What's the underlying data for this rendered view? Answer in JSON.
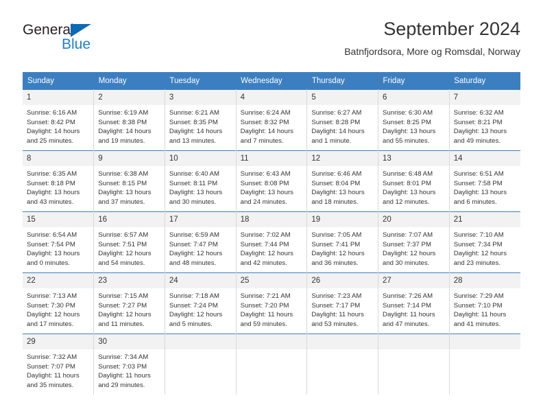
{
  "brand": {
    "name_part1": "General",
    "name_part2": "Blue",
    "triangle_color": "#0a6ab5",
    "text_color": "#1b7fd4"
  },
  "header": {
    "title": "September 2024",
    "subtitle": "Batnfjordsora, More og Romsdal, Norway"
  },
  "theme": {
    "header_bg": "#3c7fc1",
    "header_text": "#ffffff",
    "daynum_bg": "#f2f2f2",
    "cell_bg": "#ffffff",
    "grid_line": "#d8d8d8",
    "week_top_line": "#3c7fc1",
    "body_text": "#333333"
  },
  "labels": {
    "sunrise": "Sunrise:",
    "sunset": "Sunset:",
    "daylight": "Daylight:"
  },
  "weekdays": [
    "Sunday",
    "Monday",
    "Tuesday",
    "Wednesday",
    "Thursday",
    "Friday",
    "Saturday"
  ],
  "weeks": [
    [
      {
        "day": "1",
        "sunrise": "Sunrise: 6:16 AM",
        "sunset": "Sunset: 8:42 PM",
        "daylight": "Daylight: 14 hours and 25 minutes."
      },
      {
        "day": "2",
        "sunrise": "Sunrise: 6:19 AM",
        "sunset": "Sunset: 8:38 PM",
        "daylight": "Daylight: 14 hours and 19 minutes."
      },
      {
        "day": "3",
        "sunrise": "Sunrise: 6:21 AM",
        "sunset": "Sunset: 8:35 PM",
        "daylight": "Daylight: 14 hours and 13 minutes."
      },
      {
        "day": "4",
        "sunrise": "Sunrise: 6:24 AM",
        "sunset": "Sunset: 8:32 PM",
        "daylight": "Daylight: 14 hours and 7 minutes."
      },
      {
        "day": "5",
        "sunrise": "Sunrise: 6:27 AM",
        "sunset": "Sunset: 8:28 PM",
        "daylight": "Daylight: 14 hours and 1 minute."
      },
      {
        "day": "6",
        "sunrise": "Sunrise: 6:30 AM",
        "sunset": "Sunset: 8:25 PM",
        "daylight": "Daylight: 13 hours and 55 minutes."
      },
      {
        "day": "7",
        "sunrise": "Sunrise: 6:32 AM",
        "sunset": "Sunset: 8:21 PM",
        "daylight": "Daylight: 13 hours and 49 minutes."
      }
    ],
    [
      {
        "day": "8",
        "sunrise": "Sunrise: 6:35 AM",
        "sunset": "Sunset: 8:18 PM",
        "daylight": "Daylight: 13 hours and 43 minutes."
      },
      {
        "day": "9",
        "sunrise": "Sunrise: 6:38 AM",
        "sunset": "Sunset: 8:15 PM",
        "daylight": "Daylight: 13 hours and 37 minutes."
      },
      {
        "day": "10",
        "sunrise": "Sunrise: 6:40 AM",
        "sunset": "Sunset: 8:11 PM",
        "daylight": "Daylight: 13 hours and 30 minutes."
      },
      {
        "day": "11",
        "sunrise": "Sunrise: 6:43 AM",
        "sunset": "Sunset: 8:08 PM",
        "daylight": "Daylight: 13 hours and 24 minutes."
      },
      {
        "day": "12",
        "sunrise": "Sunrise: 6:46 AM",
        "sunset": "Sunset: 8:04 PM",
        "daylight": "Daylight: 13 hours and 18 minutes."
      },
      {
        "day": "13",
        "sunrise": "Sunrise: 6:48 AM",
        "sunset": "Sunset: 8:01 PM",
        "daylight": "Daylight: 13 hours and 12 minutes."
      },
      {
        "day": "14",
        "sunrise": "Sunrise: 6:51 AM",
        "sunset": "Sunset: 7:58 PM",
        "daylight": "Daylight: 13 hours and 6 minutes."
      }
    ],
    [
      {
        "day": "15",
        "sunrise": "Sunrise: 6:54 AM",
        "sunset": "Sunset: 7:54 PM",
        "daylight": "Daylight: 13 hours and 0 minutes."
      },
      {
        "day": "16",
        "sunrise": "Sunrise: 6:57 AM",
        "sunset": "Sunset: 7:51 PM",
        "daylight": "Daylight: 12 hours and 54 minutes."
      },
      {
        "day": "17",
        "sunrise": "Sunrise: 6:59 AM",
        "sunset": "Sunset: 7:47 PM",
        "daylight": "Daylight: 12 hours and 48 minutes."
      },
      {
        "day": "18",
        "sunrise": "Sunrise: 7:02 AM",
        "sunset": "Sunset: 7:44 PM",
        "daylight": "Daylight: 12 hours and 42 minutes."
      },
      {
        "day": "19",
        "sunrise": "Sunrise: 7:05 AM",
        "sunset": "Sunset: 7:41 PM",
        "daylight": "Daylight: 12 hours and 36 minutes."
      },
      {
        "day": "20",
        "sunrise": "Sunrise: 7:07 AM",
        "sunset": "Sunset: 7:37 PM",
        "daylight": "Daylight: 12 hours and 30 minutes."
      },
      {
        "day": "21",
        "sunrise": "Sunrise: 7:10 AM",
        "sunset": "Sunset: 7:34 PM",
        "daylight": "Daylight: 12 hours and 23 minutes."
      }
    ],
    [
      {
        "day": "22",
        "sunrise": "Sunrise: 7:13 AM",
        "sunset": "Sunset: 7:30 PM",
        "daylight": "Daylight: 12 hours and 17 minutes."
      },
      {
        "day": "23",
        "sunrise": "Sunrise: 7:15 AM",
        "sunset": "Sunset: 7:27 PM",
        "daylight": "Daylight: 12 hours and 11 minutes."
      },
      {
        "day": "24",
        "sunrise": "Sunrise: 7:18 AM",
        "sunset": "Sunset: 7:24 PM",
        "daylight": "Daylight: 12 hours and 5 minutes."
      },
      {
        "day": "25",
        "sunrise": "Sunrise: 7:21 AM",
        "sunset": "Sunset: 7:20 PM",
        "daylight": "Daylight: 11 hours and 59 minutes."
      },
      {
        "day": "26",
        "sunrise": "Sunrise: 7:23 AM",
        "sunset": "Sunset: 7:17 PM",
        "daylight": "Daylight: 11 hours and 53 minutes."
      },
      {
        "day": "27",
        "sunrise": "Sunrise: 7:26 AM",
        "sunset": "Sunset: 7:14 PM",
        "daylight": "Daylight: 11 hours and 47 minutes."
      },
      {
        "day": "28",
        "sunrise": "Sunrise: 7:29 AM",
        "sunset": "Sunset: 7:10 PM",
        "daylight": "Daylight: 11 hours and 41 minutes."
      }
    ],
    [
      {
        "day": "29",
        "sunrise": "Sunrise: 7:32 AM",
        "sunset": "Sunset: 7:07 PM",
        "daylight": "Daylight: 11 hours and 35 minutes."
      },
      {
        "day": "30",
        "sunrise": "Sunrise: 7:34 AM",
        "sunset": "Sunset: 7:03 PM",
        "daylight": "Daylight: 11 hours and 29 minutes."
      },
      {
        "day": "",
        "sunrise": "",
        "sunset": "",
        "daylight": ""
      },
      {
        "day": "",
        "sunrise": "",
        "sunset": "",
        "daylight": ""
      },
      {
        "day": "",
        "sunrise": "",
        "sunset": "",
        "daylight": ""
      },
      {
        "day": "",
        "sunrise": "",
        "sunset": "",
        "daylight": ""
      },
      {
        "day": "",
        "sunrise": "",
        "sunset": "",
        "daylight": ""
      }
    ]
  ]
}
